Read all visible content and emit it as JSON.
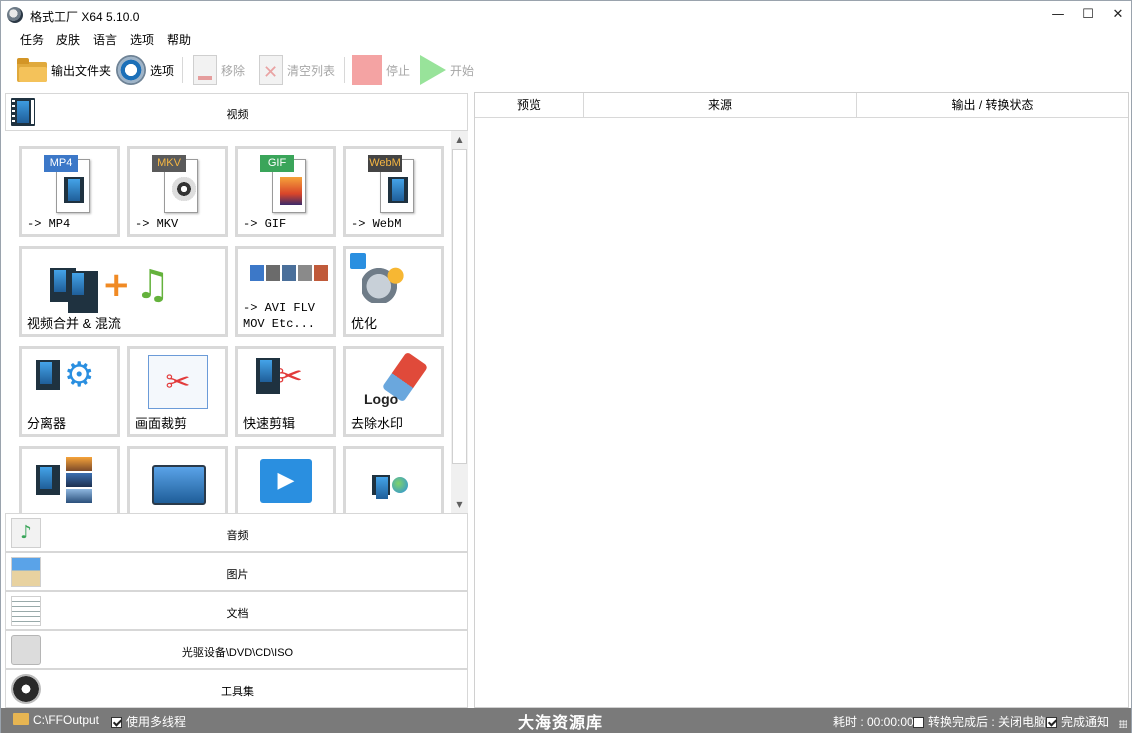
{
  "window": {
    "title": "格式工厂 X64 5.10.0",
    "controls": {
      "minimize": "—",
      "maximize": "☐",
      "close": "✕"
    }
  },
  "menu": [
    "任务",
    "皮肤",
    "语言",
    "选项",
    "帮助"
  ],
  "toolbar": {
    "output_folder": "输出文件夹",
    "options": "选项",
    "remove": "移除",
    "clear_list": "清空列表",
    "stop": "停止",
    "start": "开始"
  },
  "categories": {
    "video": "视频",
    "audio": "音频",
    "image": "图片",
    "document": "文档",
    "disc": "光驱设备\\DVD\\CD\\ISO",
    "tools": "工具集"
  },
  "video_tiles": [
    {
      "label": "-> MP4",
      "tag": "MP4",
      "tag_color": "#3c78c8"
    },
    {
      "label": "-> MKV",
      "tag": "MKV",
      "tag_color": "#5a5a5a"
    },
    {
      "label": "-> GIF",
      "tag": "GIF",
      "tag_color": "#3aa55a"
    },
    {
      "label": "-> WebM",
      "tag": "WebM",
      "tag_color": "#444444"
    },
    {
      "label": "视频合并 & 混流"
    },
    {
      "label": "-> AVI FLV\nMOV Etc..."
    },
    {
      "label": "优化"
    },
    {
      "label": "分离器"
    },
    {
      "label": "画面裁剪"
    },
    {
      "label": "快速剪辑"
    },
    {
      "label": "去除水印",
      "logo_text": "Logo"
    }
  ],
  "list_columns": [
    "预览",
    "来源",
    "输出 / 转换状态"
  ],
  "status": {
    "output_path": "C:\\FFOutput",
    "multithread": "使用多线程",
    "multithread_checked": true,
    "watermark": "大海资源库",
    "elapsed": "耗时 : 00:00:00",
    "after_done": "转换完成后 : 关闭电脑",
    "after_done_checked": false,
    "notify": "完成通知",
    "notify_checked": true
  },
  "colors": {
    "status_bar": "#7a7a7a",
    "tile_border": "#d9d9d9",
    "stop_icon": "#f4a3a3",
    "start_icon": "#98e39a"
  }
}
